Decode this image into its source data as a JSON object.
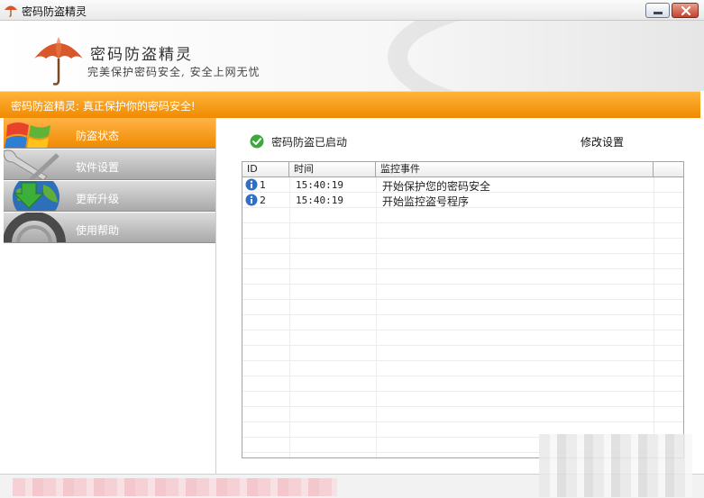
{
  "window": {
    "title": "密码防盗精灵"
  },
  "header": {
    "brand": "密码防盗精灵",
    "slogan": "完美保护密码安全, 安全上网无忧"
  },
  "banner": {
    "text": "密码防盗精灵: 真正保护你的密码安全!"
  },
  "sidebar": {
    "items": [
      {
        "label": "防盗状态",
        "icon": "windows-flag-icon",
        "active": true
      },
      {
        "label": "软件设置",
        "icon": "wrench-icon",
        "active": false
      },
      {
        "label": "更新升级",
        "icon": "globe-download-icon",
        "active": false
      },
      {
        "label": "使用帮助",
        "icon": "lifebuoy-icon",
        "active": false
      }
    ]
  },
  "main": {
    "status_text": "密码防盗已启动",
    "settings_link": "修改设置",
    "table": {
      "columns": [
        "ID",
        "时间",
        "监控事件",
        ""
      ],
      "rows": [
        {
          "id": "1",
          "time": "15:40:19",
          "event": "开始保护您的密码安全"
        },
        {
          "id": "2",
          "time": "15:40:19",
          "event": "开始监控盗号程序"
        }
      ]
    }
  },
  "colors": {
    "accent_orange": "#f08a00",
    "banner_text": "#ffffff",
    "status_green": "#3ea83e",
    "info_blue": "#2f6fc4"
  }
}
